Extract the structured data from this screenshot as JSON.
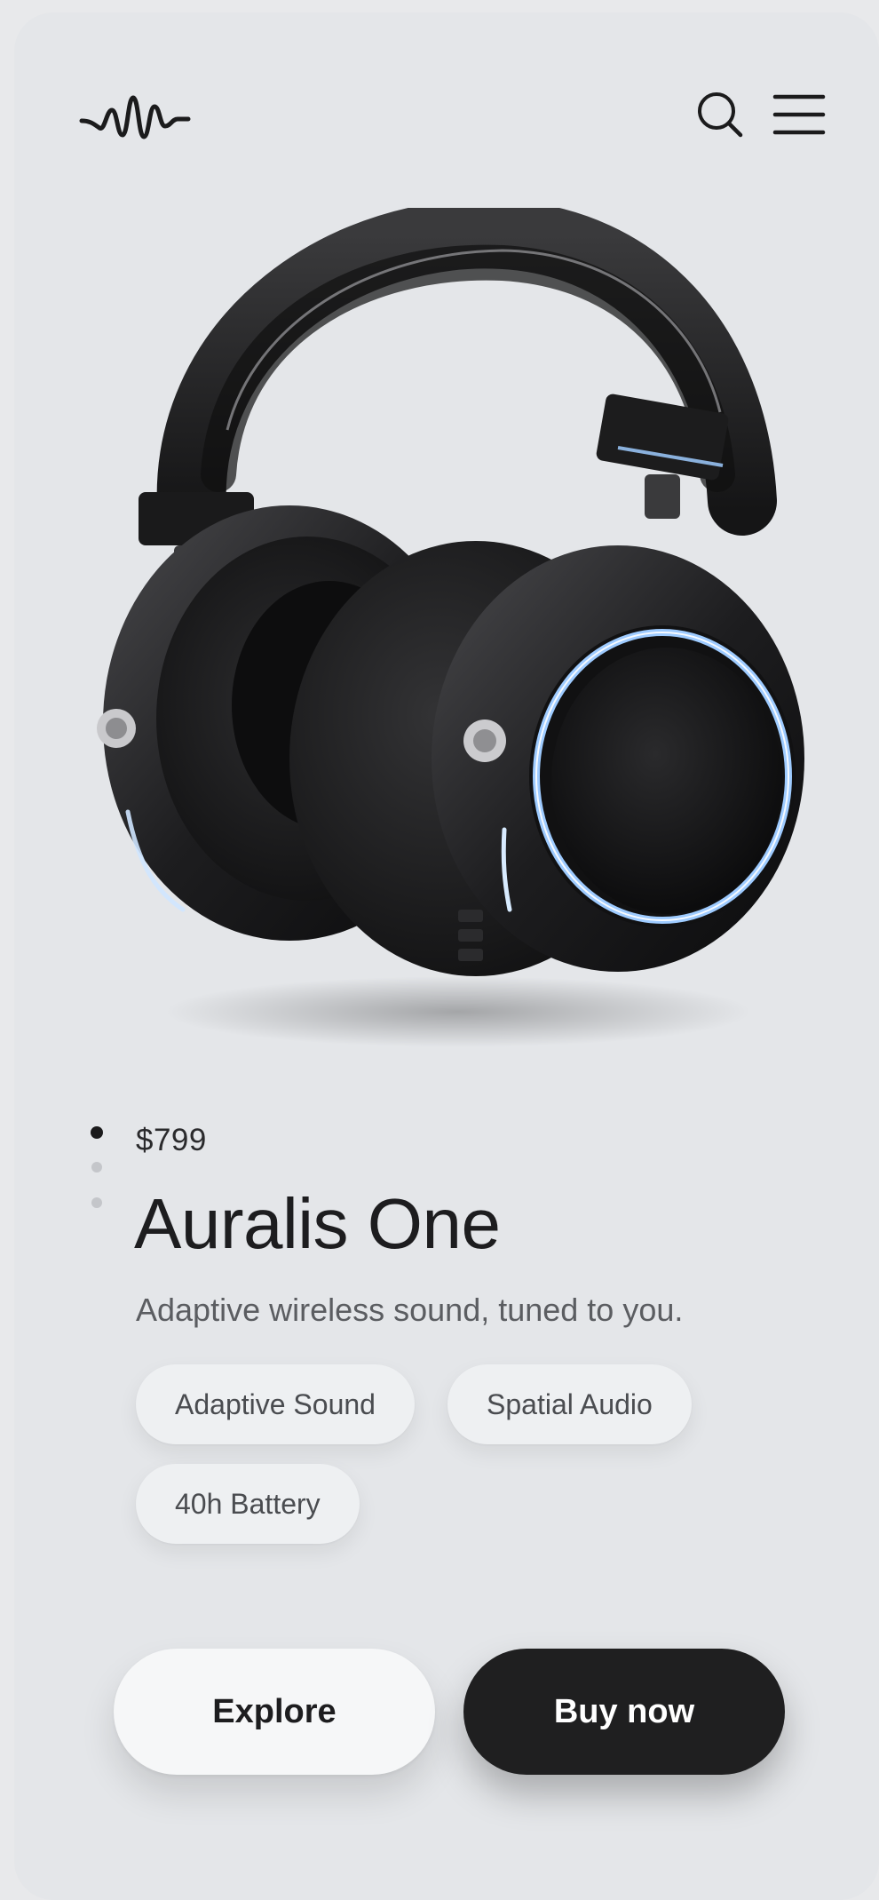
{
  "header": {
    "logo_icon": "waveform-logo-icon",
    "search_icon": "search-icon",
    "menu_icon": "hamburger-menu-icon"
  },
  "hero": {
    "image_subject": "over-ear headphones"
  },
  "carousel": {
    "total": 3,
    "active_index": 0
  },
  "product": {
    "price": "$799",
    "name": "Auralis One",
    "tagline": "Adaptive wireless sound, tuned to you.",
    "features": [
      "Adaptive Sound",
      "Spatial Audio",
      "40h Battery"
    ]
  },
  "actions": {
    "explore_label": "Explore",
    "buy_label": "Buy now"
  },
  "colors": {
    "background": "#e4e6e9",
    "accent_dark": "#1f1f20",
    "glow_blue": "#9ecbff"
  }
}
